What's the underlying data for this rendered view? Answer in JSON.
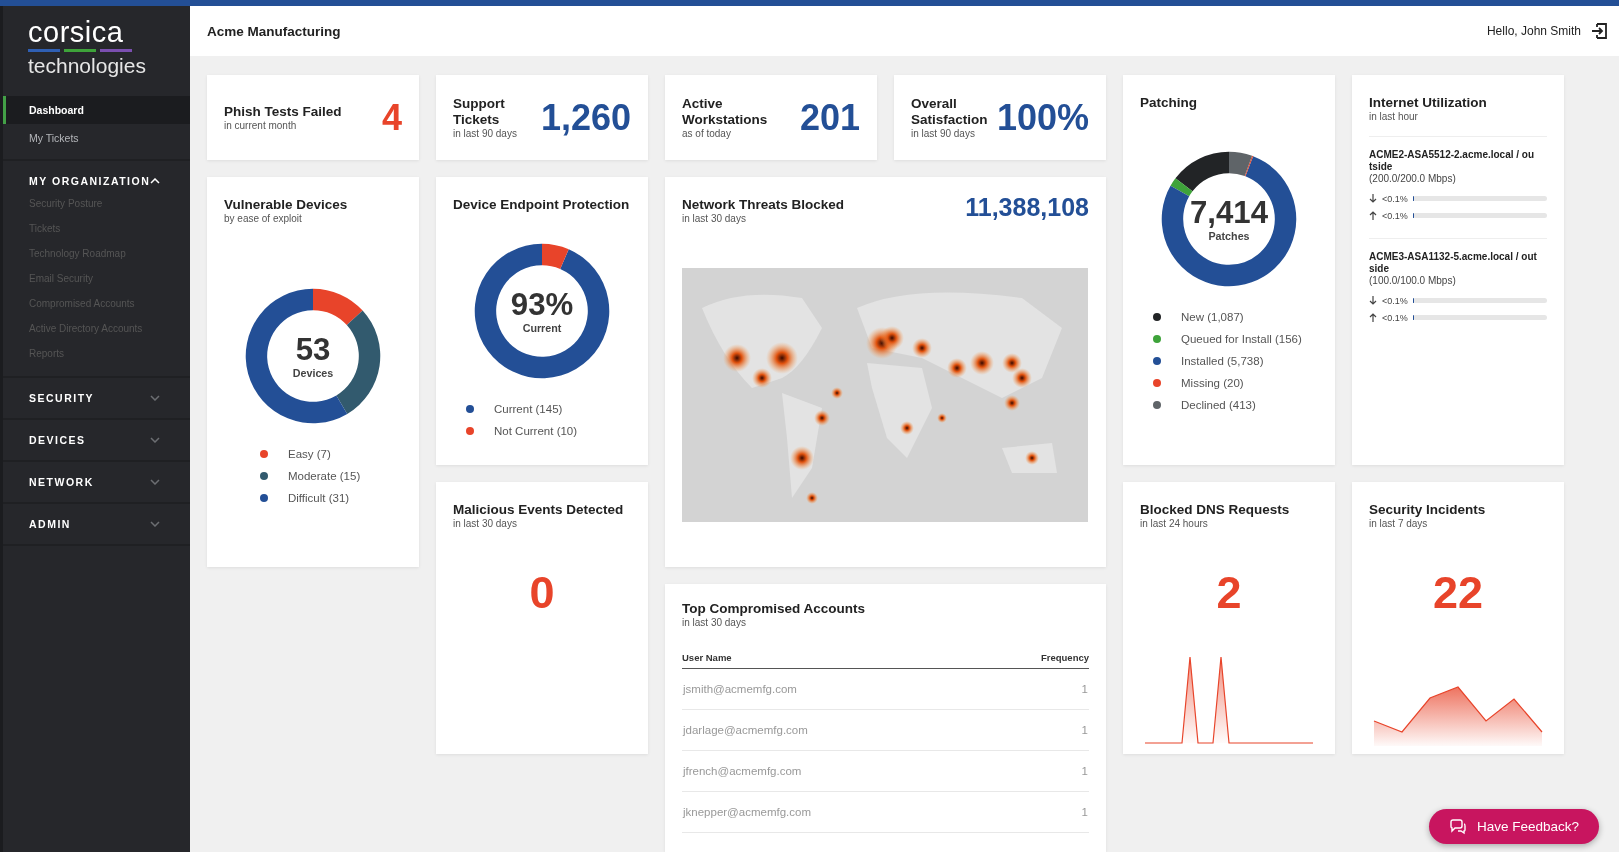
{
  "header": {
    "company": "Acme Manufacturing",
    "greeting": "Hello, John Smith"
  },
  "sidebar": {
    "logo": {
      "line1": "corsica",
      "line2": "technologies"
    },
    "items": [
      {
        "label": "Dashboard",
        "selected": true
      },
      {
        "label": "My Tickets",
        "selected": false
      }
    ],
    "sections": [
      {
        "label": "MY ORGANIZATION",
        "expanded": true,
        "items": [
          {
            "label": "Security Posture",
            "selected": false
          },
          {
            "label": "Tickets",
            "selected": false
          },
          {
            "label": "Technology Roadmap",
            "selected": false
          },
          {
            "label": "Email Security",
            "selected": false
          },
          {
            "label": "Compromised Accounts",
            "selected": false
          },
          {
            "label": "Active Directory Accounts",
            "selected": false
          },
          {
            "label": "Reports",
            "selected": false
          }
        ]
      },
      {
        "label": "SECURITY",
        "expanded": false
      },
      {
        "label": "DEVICES",
        "expanded": false
      },
      {
        "label": "NETWORK",
        "expanded": false
      },
      {
        "label": "ADMIN",
        "expanded": false
      }
    ]
  },
  "stats": [
    {
      "title": "Phish Tests Failed",
      "subtitle": "in current month",
      "value": "4",
      "kind": "alert"
    },
    {
      "title": "Support Tickets",
      "subtitle": "in last 90 days",
      "value": "1,260",
      "kind": "info"
    },
    {
      "title": "Active Workstations",
      "subtitle": "as of today",
      "value": "201",
      "kind": "info"
    },
    {
      "title": "Overall Satisfaction",
      "subtitle": "in last 90 days",
      "value": "100%",
      "kind": "info"
    }
  ],
  "vulnerable_devices": {
    "title": "Vulnerable Devices",
    "subtitle": "by ease of exploit",
    "center_value": "53",
    "center_label": "Devices",
    "chart_data": {
      "type": "donut",
      "categories": [
        "Easy",
        "Moderate",
        "Difficult"
      ],
      "values": [
        13.2,
        28.3,
        58.5
      ]
    },
    "legend": [
      {
        "count": "(7)",
        "color": "#e8442a"
      },
      {
        "count": "(15)",
        "color": "#325a6e"
      },
      {
        "count": "(31)",
        "color": "#234f96"
      }
    ]
  },
  "endpoint_protection": {
    "title": "Device Endpoint Protection",
    "center_value": "93%",
    "center_label": "Current",
    "chart_data": {
      "type": "donut",
      "categories": [
        "Current",
        "Not Current"
      ],
      "values": [
        93.5,
        6.5
      ]
    },
    "legend": [
      {
        "count": "(145)",
        "color": "#234f96"
      },
      {
        "count": "(10)",
        "color": "#e8442a"
      }
    ]
  },
  "network_threats": {
    "title": "Network Threats Blocked",
    "subtitle": "in last 30 days",
    "value": "11,388,108"
  },
  "patching": {
    "title": "Patching",
    "center_value": "7,414",
    "center_label": "Patches",
    "chart_data": {
      "type": "donut",
      "categories": [
        "New",
        "Queued for Install",
        "Installed",
        "Missing",
        "Declined"
      ],
      "values": [
        14.66,
        2.1,
        77.4,
        0.27,
        5.57
      ]
    },
    "legend": [
      {
        "count": "(1,087)",
        "color": "#222426"
      },
      {
        "count": "(156)",
        "color": "#3ea33a"
      },
      {
        "count": "(5,738)",
        "color": "#234f96"
      },
      {
        "count": "(20)",
        "color": "#e8442a"
      },
      {
        "count": "(413)",
        "color": "#5f6468"
      }
    ]
  },
  "internet_utilization": {
    "title": "Internet Utilization",
    "subtitle": "in last hour",
    "links": [
      {
        "name": "ACME2-ASA5512-2.acme.local / outside",
        "capacity": "(200.0/200.0 Mbps)",
        "rates": [
          {
            "kind": "down",
            "reading": "<0.1%",
            "level": 0.001
          },
          {
            "kind": "up",
            "reading": "<0.1%",
            "level": 0.001
          }
        ]
      },
      {
        "name": "ACME3-ASA1132-5.acme.local / outside",
        "capacity": "(100.0/100.0 Mbps)",
        "rates": [
          {
            "kind": "down",
            "reading": "<0.1%",
            "level": 0.001
          },
          {
            "kind": "up",
            "reading": "<0.1%",
            "level": 0.001
          }
        ]
      }
    ]
  },
  "malicious_events": {
    "title": "Malicious Events Detected",
    "subtitle": "in last 30 days",
    "value": "0"
  },
  "blocked_dns": {
    "title": "Blocked DNS Requests",
    "subtitle": "in last 24 hours",
    "value": "2",
    "kind": "spikes"
  },
  "security_incidents": {
    "title": "Security Incidents",
    "subtitle": "in last 7 days",
    "value": "22",
    "kind": "area"
  },
  "compromised_accounts": {
    "title": "Top Compromised Accounts",
    "subtitle": "in last 30 days",
    "columns": [
      "User Name",
      "Frequency"
    ],
    "rows": [
      {
        "user": "jsmith@acmemfg.com",
        "frequency": "1"
      },
      {
        "user": "jdarlage@acmemfg.com",
        "frequency": "1"
      },
      {
        "user": "jfrench@acmemfg.com",
        "frequency": "1"
      },
      {
        "user": "jknepper@acmemfg.com",
        "frequency": "1"
      }
    ]
  },
  "feedback_button": {
    "label": "Have Feedback?"
  }
}
